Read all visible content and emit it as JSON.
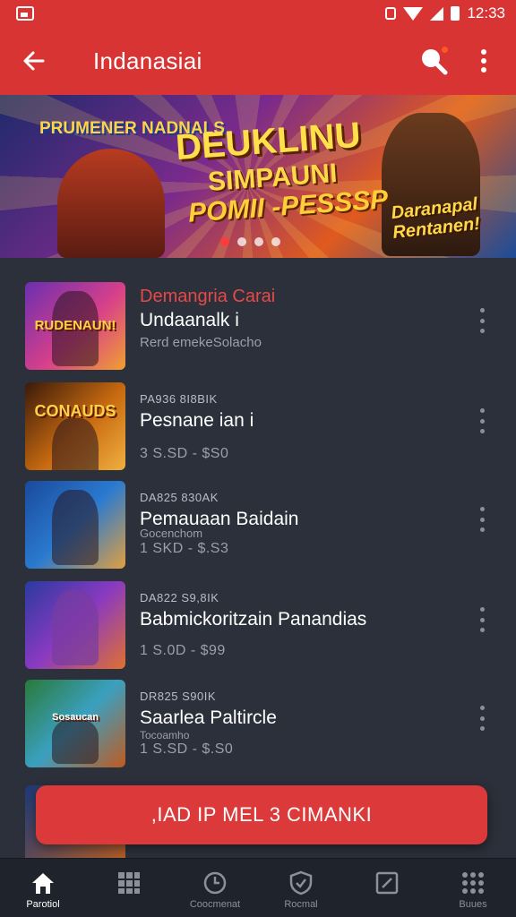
{
  "status_bar": {
    "time": "12:33"
  },
  "app_bar": {
    "title": "Indanasiai"
  },
  "banner": {
    "logo": "PRUMENER NADNALS",
    "title_line1": "DEUKLINU",
    "title_line2": "SIMPAUNI",
    "title_line3": "POMII -PESSSP",
    "badge": "Daranapal Rentanen!",
    "slides": 4,
    "active_slide": 1
  },
  "list": {
    "items": [
      {
        "thumb_label": "RUDENAUN!",
        "line1": "Demangria Carai",
        "line2": "Undaanalk  i",
        "line3": "Rerd emekeSolacho",
        "line4": ""
      },
      {
        "thumb_label": "CONAUDS",
        "line1": "PA936 8I8BIK",
        "line2": "Pesnane ian  i",
        "line3": "",
        "line4": "3 S.SD - $S0"
      },
      {
        "thumb_label": "",
        "line1": "DA825 830AK",
        "line2": "Pemauaan Baidain",
        "line3": "Gocenchom",
        "line4": "1 SKD - $.S3"
      },
      {
        "thumb_label": "",
        "line1": "DA822 S9,8IK",
        "line2": "Babmickoritzain Panandias",
        "line3": "",
        "line4": "1 S.0D - $99"
      },
      {
        "thumb_label": "Sosaucan",
        "line1": "DR825 S90IK",
        "line2": "Saarlea Paltircle",
        "line3": "Tocoamho",
        "line4": "1 S.SD - $.S0"
      }
    ]
  },
  "cta": {
    "label": ",IAD IP MEL 3 CIMANKI"
  },
  "bottom_nav": {
    "items": [
      {
        "label": "Parotiol",
        "icon": "home-icon"
      },
      {
        "label": "",
        "icon": "grid-icon"
      },
      {
        "label": "Coocmenat",
        "icon": "clock-icon"
      },
      {
        "label": "Rocmal",
        "icon": "shield-icon"
      },
      {
        "label": "",
        "icon": "edit-icon"
      },
      {
        "label": "Buues",
        "icon": "apps-icon"
      }
    ]
  },
  "colors": {
    "accent": "#d93434",
    "background": "#2b303a",
    "nav": "#1f232b"
  }
}
